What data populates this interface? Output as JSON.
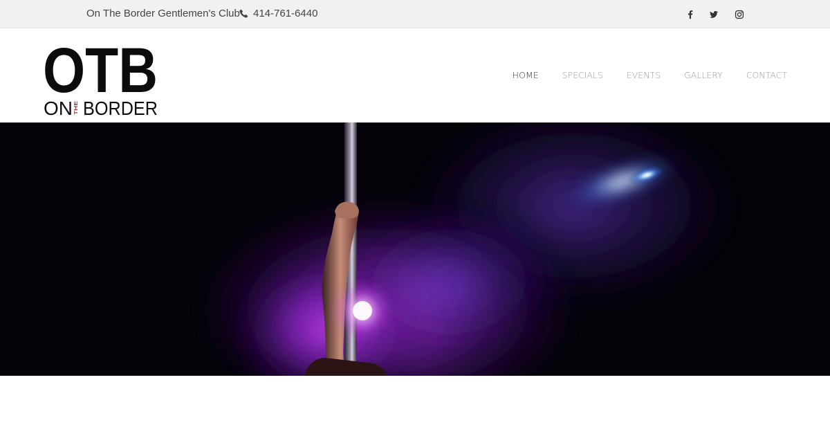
{
  "topbar": {
    "club_name": "On The Border Gentlemen's Club",
    "phone": "414-761-6440",
    "social_icons": [
      "facebook-icon",
      "twitter-icon",
      "instagram-icon"
    ]
  },
  "logo": {
    "main": "OTB",
    "left_word": "ON",
    "small_word": "THE",
    "right_word": "BORDER",
    "accent_color": "#d0302b"
  },
  "nav": {
    "items": [
      {
        "label": "HOME",
        "active": true
      },
      {
        "label": "SPECIALS",
        "active": false
      },
      {
        "label": "EVENTS",
        "active": false
      },
      {
        "label": "GALLERY",
        "active": false
      },
      {
        "label": "CONTACT",
        "active": false
      }
    ]
  },
  "hero": {
    "description_colors": {
      "smoke": "#9b2de0",
      "light": "#5aa8ff",
      "background": "#050208"
    }
  }
}
